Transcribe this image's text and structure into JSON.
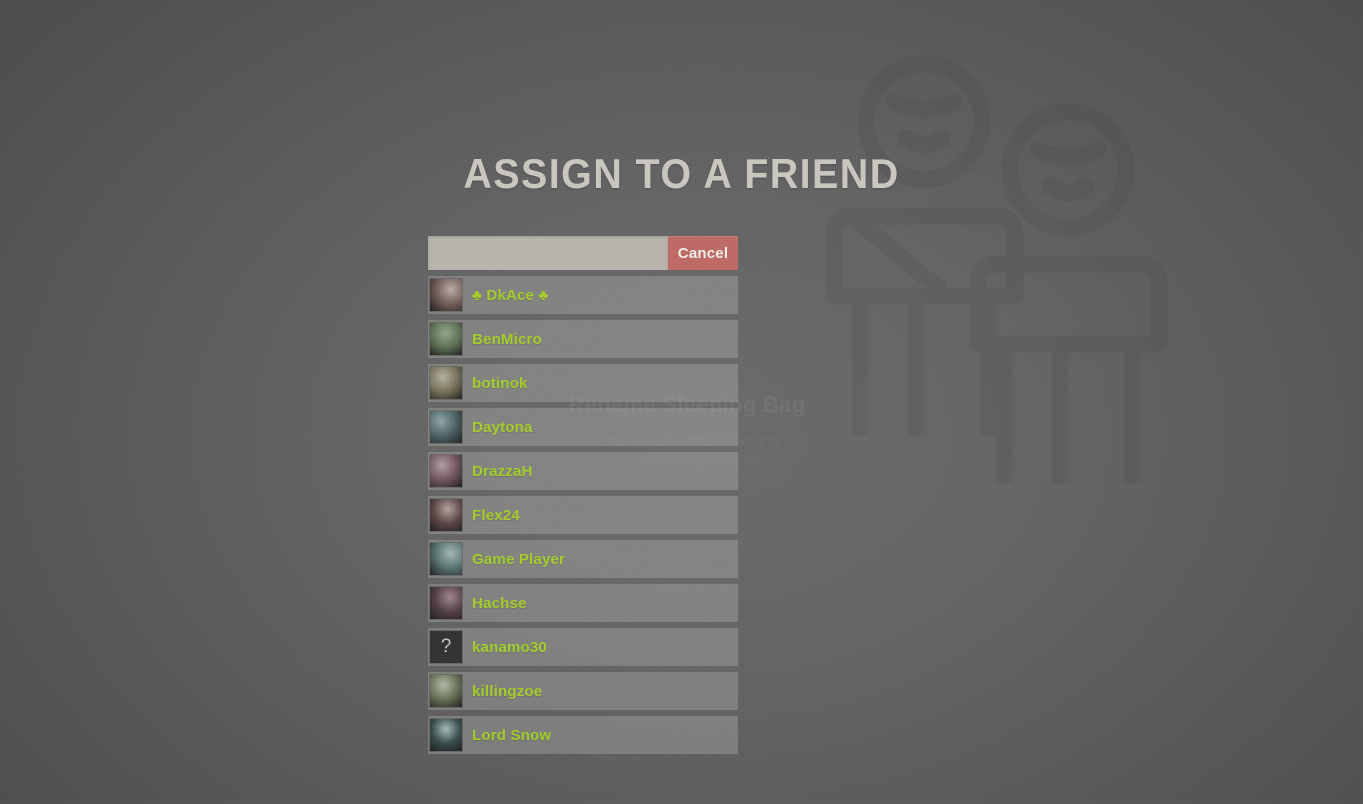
{
  "page": {
    "title": "ASSIGN TO A FRIEND",
    "accent_green": "#a5cf28",
    "cancel_red": "#c06a66",
    "title_color": "#cbc8c0"
  },
  "search": {
    "value": "",
    "placeholder": "",
    "cancel_label": "Cancel"
  },
  "background_dialog": {
    "title": "Rename Sleeping Bag",
    "subtitle_line1": "Enter a new name below and",
    "subtitle_line2": "press accept or press cancel"
  },
  "watermark": {
    "name": "two-friends-icon"
  },
  "friends": [
    {
      "name": "♣ DkAce ♣",
      "avatar": "art-dkace"
    },
    {
      "name": "BenMicro",
      "avatar": "art-benmicro"
    },
    {
      "name": "botinok",
      "avatar": "art-botinok"
    },
    {
      "name": "Daytona",
      "avatar": "art-daytona"
    },
    {
      "name": "DrazzaH",
      "avatar": "art-drazzah"
    },
    {
      "name": "Flex24",
      "avatar": "art-flex24"
    },
    {
      "name": "Game Player",
      "avatar": "art-gameplayer"
    },
    {
      "name": "Hachse",
      "avatar": "art-hachse"
    },
    {
      "name": "kanamo30",
      "avatar": "unknown",
      "avatar_glyph": "?"
    },
    {
      "name": "killingzoe",
      "avatar": "art-killingzoe"
    },
    {
      "name": "Lord Snow",
      "avatar": "art-lordsnow"
    }
  ]
}
